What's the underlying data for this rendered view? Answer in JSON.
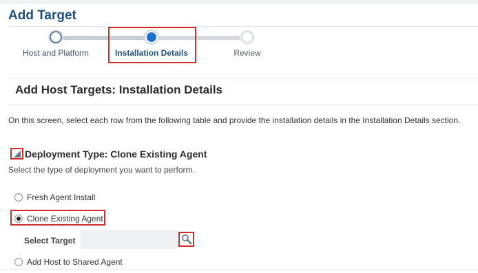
{
  "page": {
    "title": "Add Target"
  },
  "train": {
    "steps": [
      {
        "label": "Host and Platform",
        "state": "visited"
      },
      {
        "label": "Installation Details",
        "state": "current"
      },
      {
        "label": "Review",
        "state": "future"
      }
    ]
  },
  "section": {
    "title": "Add Host Targets: Installation Details",
    "instruction": "On this screen, select each row from the following table and provide the installation details in the Installation Details section."
  },
  "deployment": {
    "title": "Deployment Type: Clone Existing Agent",
    "hint": "Select the type of deployment you want to perform.",
    "options": [
      {
        "label": "Fresh Agent Install",
        "checked": false
      },
      {
        "label": "Clone Existing Agent",
        "checked": true
      },
      {
        "label": "Add Host to Shared Agent",
        "checked": false
      }
    ],
    "select_target": {
      "label": "Select Target",
      "value": "",
      "icon": "search-icon"
    }
  },
  "colors": {
    "accent": "#1d73c9",
    "title": "#1f4e79",
    "highlight": "#d42a2a"
  }
}
